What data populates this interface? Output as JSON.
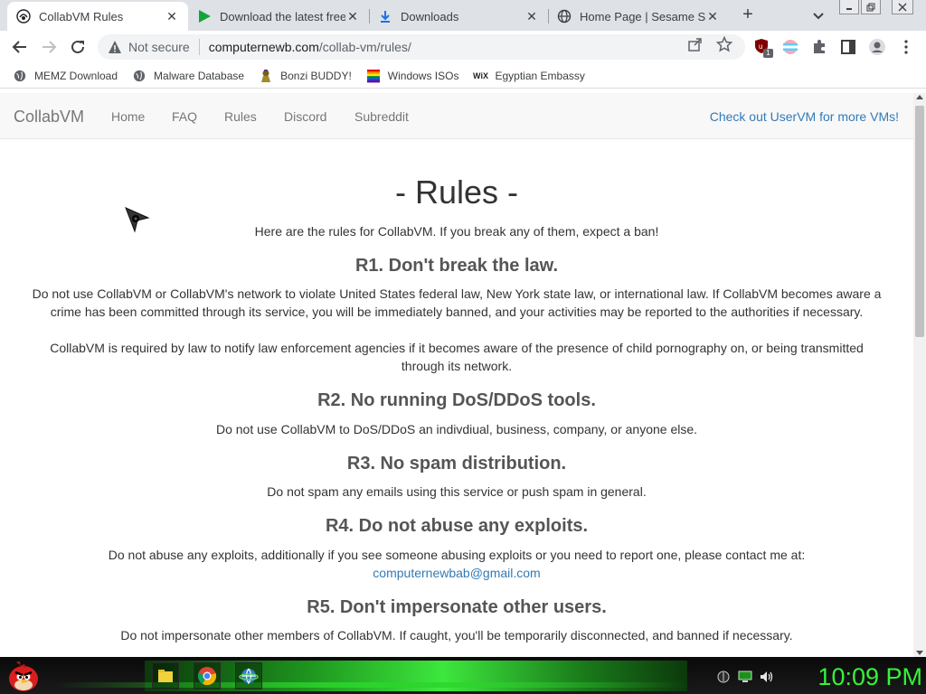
{
  "tabs": [
    {
      "title": "CollabVM Rules",
      "favicon": "collabvm-icon",
      "active": true
    },
    {
      "title": "Download the latest free",
      "favicon": "play-icon",
      "active": false
    },
    {
      "title": "Downloads",
      "favicon": "download-icon",
      "active": false
    },
    {
      "title": "Home Page | Sesame Stre",
      "favicon": "globe-icon",
      "active": false
    }
  ],
  "toolbar": {
    "security_label": "Not secure",
    "url_host": "computernewb.com",
    "url_path": "/collab-vm/rules/",
    "extension_badge": "1"
  },
  "bookmarks": [
    {
      "label": "MEMZ Download",
      "icon": "globe-icon"
    },
    {
      "label": "Malware Database",
      "icon": "globe-icon"
    },
    {
      "label": "Bonzi BUDDY!",
      "icon": "bonzi-icon"
    },
    {
      "label": "Windows ISOs",
      "icon": "windows-flag-icon"
    },
    {
      "label": "Egyptian Embassy",
      "icon": "wix-icon"
    }
  ],
  "site": {
    "brand": "CollabVM",
    "nav": [
      "Home",
      "FAQ",
      "Rules",
      "Discord",
      "Subreddit"
    ],
    "nav_right": "Check out UserVM for more VMs!"
  },
  "page": {
    "title": "- Rules -",
    "intro": "Here are the rules for CollabVM. If you break any of them, expect a ban!",
    "rules": [
      {
        "heading": "R1. Don't break the law.",
        "paragraphs": [
          "Do not use CollabVM or CollabVM's network to violate United States federal law, New York state law, or international law. If CollabVM becomes aware a crime has been committed through its service, you will be immediately banned, and your activities may be reported to the authorities if necessary.",
          "CollabVM is required by law to notify law enforcement agencies if it becomes aware of the presence of child pornography on, or being transmitted through its network."
        ]
      },
      {
        "heading": "R2. No running DoS/DDoS tools.",
        "paragraphs": [
          "Do not use CollabVM to DoS/DDoS an indivdiual, business, company, or anyone else."
        ]
      },
      {
        "heading": "R3. No spam distribution.",
        "paragraphs": [
          "Do not spam any emails using this service or push spam in general."
        ]
      },
      {
        "heading": "R4. Do not abuse any exploits.",
        "paragraphs": [
          "Do not abuse any exploits, additionally if you see someone abusing exploits or you need to report one, please contact me at:"
        ],
        "link": "computernewbab@gmail.com"
      },
      {
        "heading": "R5. Don't impersonate other users.",
        "paragraphs": [
          "Do not impersonate other members of CollabVM. If caught, you'll be temporarily disconnected, and banned if necessary."
        ]
      }
    ]
  },
  "taskbar": {
    "clock": "10:09 PM",
    "accent_color": "#35f335"
  }
}
